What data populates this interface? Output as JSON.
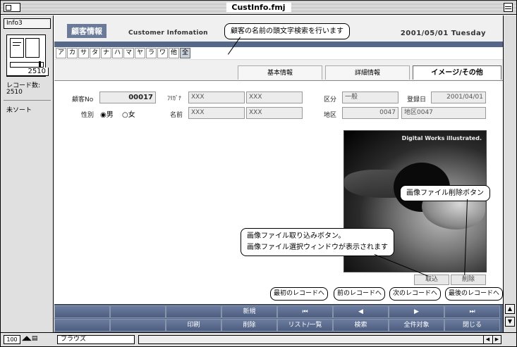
{
  "window": {
    "title": "CustInfo.fmj"
  },
  "status_area": {
    "layout": "Info3",
    "record_number": "2510",
    "records_label": "レコード数:",
    "records_count": "2510",
    "sort_state": "未ソート"
  },
  "header": {
    "title": "顧客情報",
    "subtitle": "Customer Infomation",
    "date": "2001/05/01 Tuesday"
  },
  "kana_index": [
    "ア",
    "カ",
    "サ",
    "タ",
    "ナ",
    "ハ",
    "マ",
    "ヤ",
    "ラ",
    "ワ",
    "他",
    "全"
  ],
  "tabs": [
    "基本情報",
    "詳細情報",
    "イメージ/その他"
  ],
  "form": {
    "customer_no_label": "顧客No",
    "customer_no": "00017",
    "furigana_label": "ﾌﾘｶﾞﾅ",
    "furigana_last": "XXX",
    "furigana_first": "XXX",
    "category_label": "区分",
    "category": "一般",
    "registered_label": "登録日",
    "registered": "2001/04/01",
    "gender_label": "性別",
    "gender_male": "男",
    "gender_female": "女",
    "gender_selected": "男",
    "name_label": "名前",
    "name_last": "XXX",
    "name_first": "XXX",
    "area_label": "地区",
    "area_code": "0047",
    "area_name": "地区0047"
  },
  "photo": {
    "watermark": "Digital Works illustrated."
  },
  "image_buttons": {
    "import": "取込",
    "delete": "削除"
  },
  "callouts": {
    "kana_search": "顧客の名前の頭文字検索を行います",
    "delete_btn": "画像ファイル削除ボタン",
    "import_line1": "画像ファイル取り込みボタン。",
    "import_line2": "画像ファイル選択ウィンドウが表示されます",
    "first": "最初のレコードへ",
    "prev": "前のレコードへ",
    "next": "次のレコードへ",
    "last": "最後のレコードへ"
  },
  "nav": {
    "new": "新規",
    "print": "印刷",
    "delete": "削除",
    "list": "リスト/一覧",
    "search": "検索",
    "show_all": "全件対象",
    "close": "閉じる"
  },
  "bottom": {
    "zoom": "100",
    "mode": "ブラウズ"
  }
}
